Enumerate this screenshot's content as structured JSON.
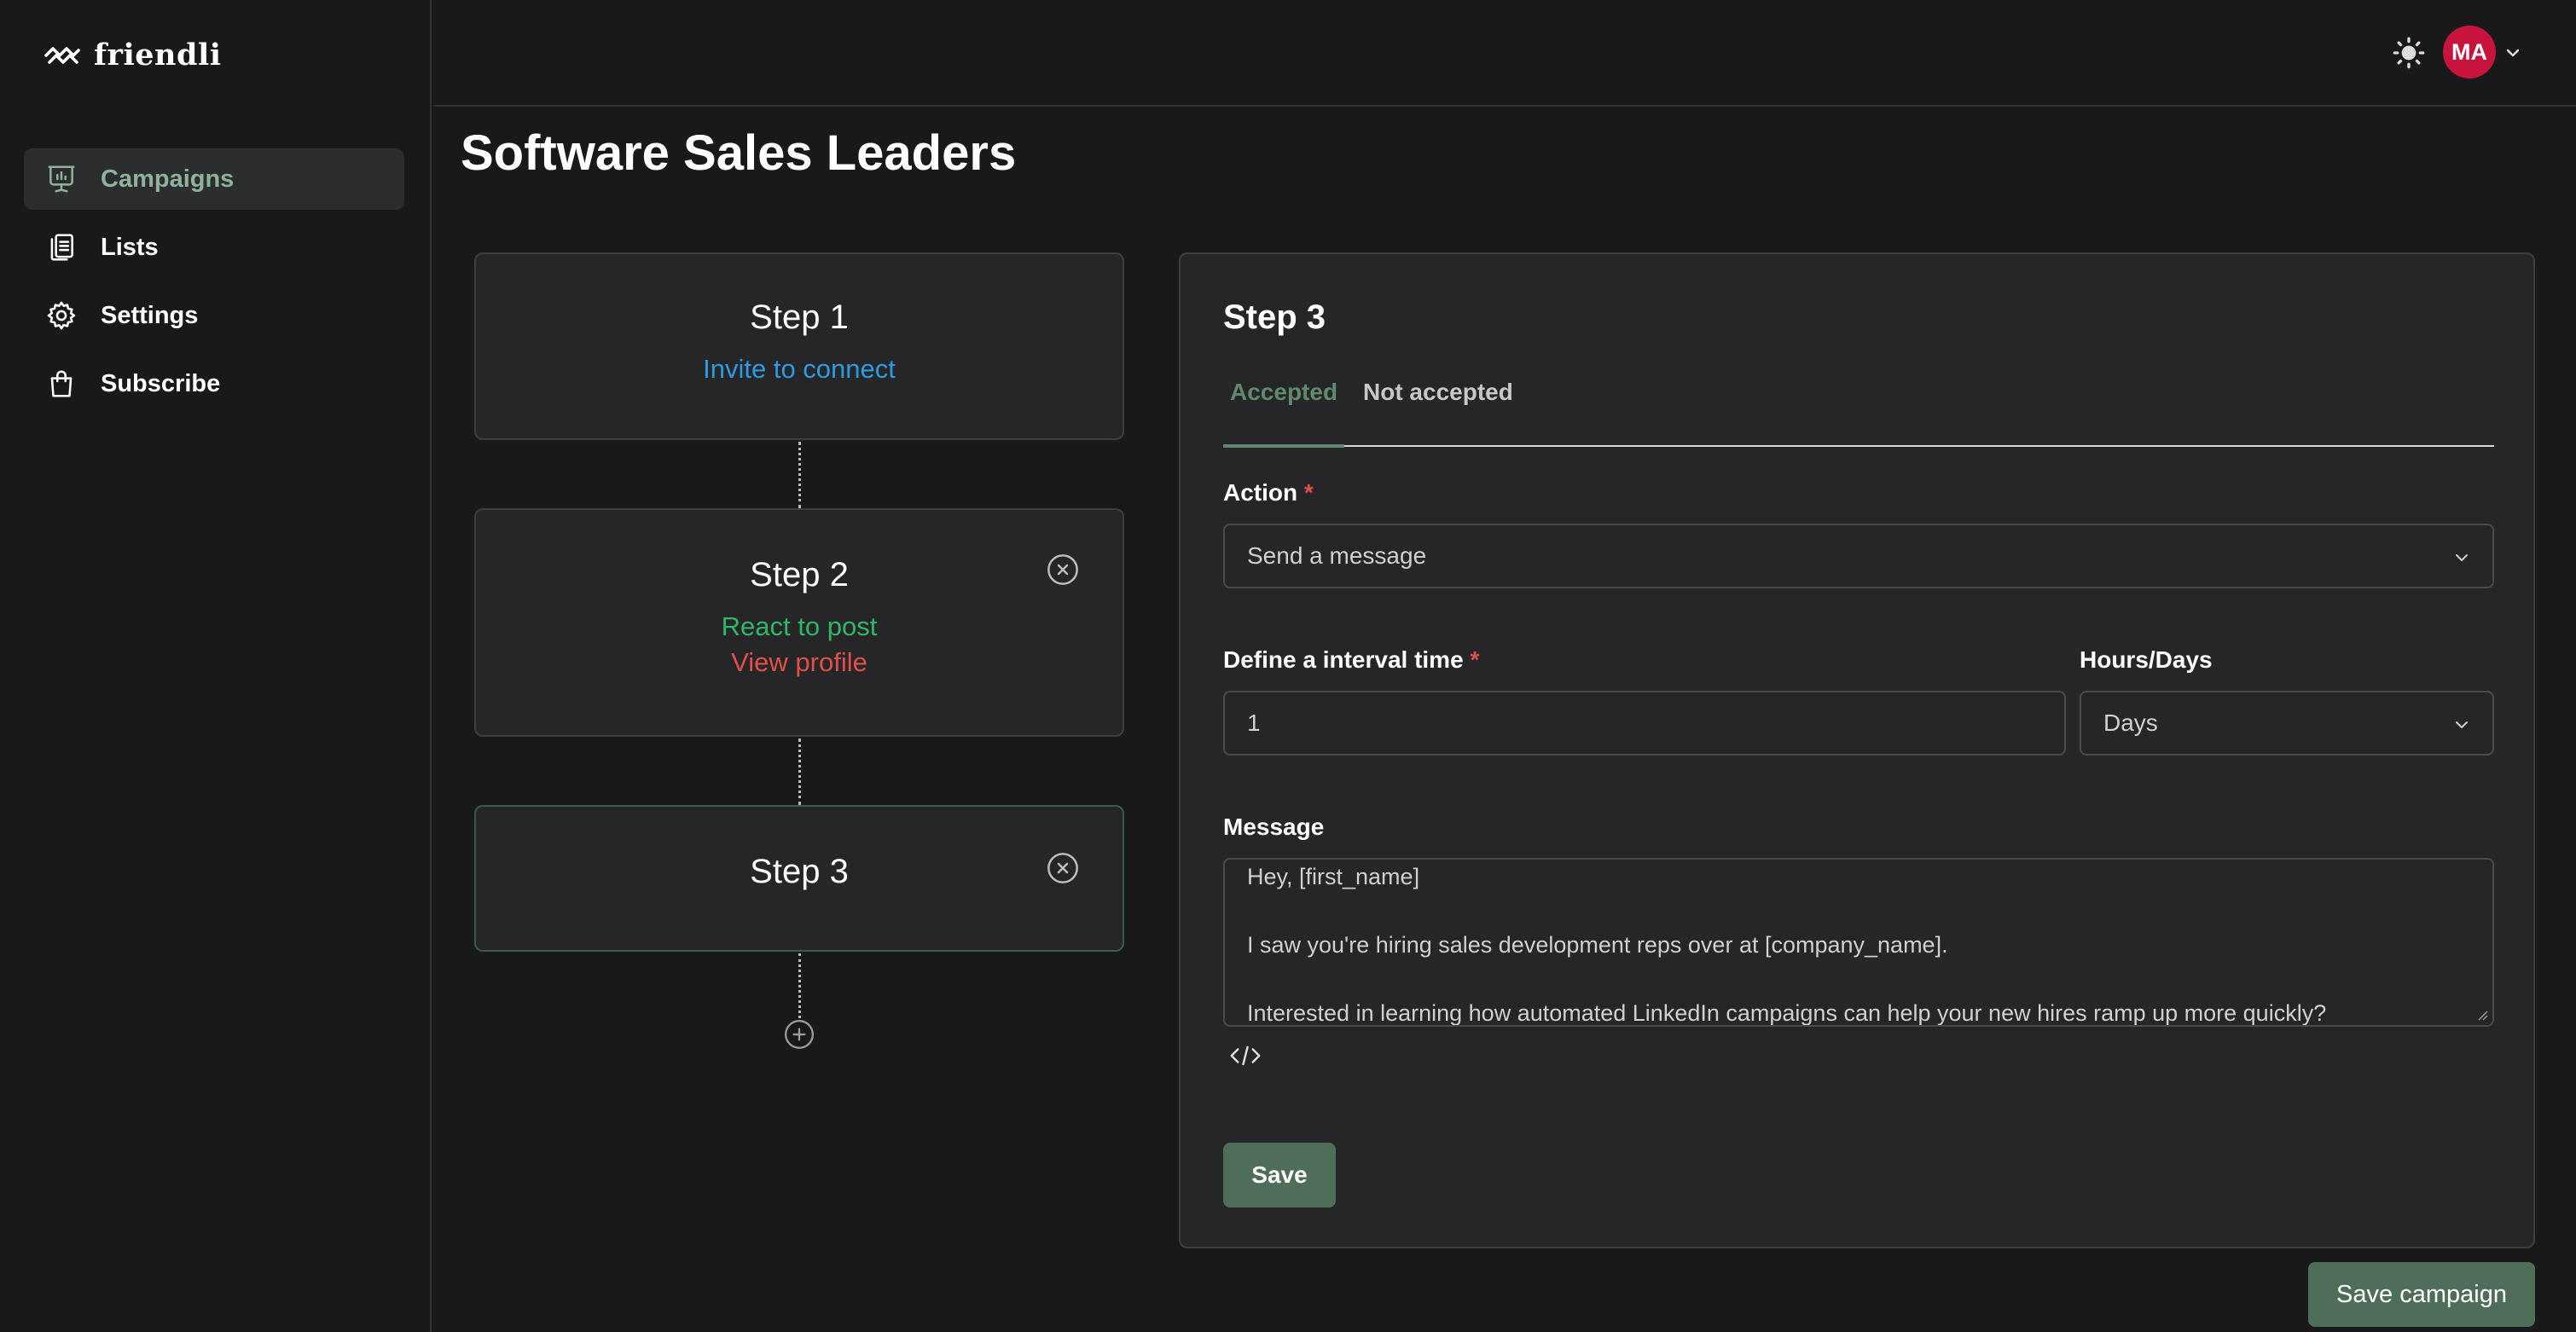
{
  "app": {
    "brand": "friendli"
  },
  "sidebar": {
    "items": [
      {
        "label": "Campaigns",
        "icon": "presentation-chart-icon",
        "active": true
      },
      {
        "label": "Lists",
        "icon": "document-list-icon",
        "active": false
      },
      {
        "label": "Settings",
        "icon": "gear-icon",
        "active": false
      },
      {
        "label": "Subscribe",
        "icon": "shopping-bag-icon",
        "active": false
      }
    ]
  },
  "header": {
    "theme_icon": "sun-icon",
    "avatar_initials": "MA",
    "avatar_color": "#c8143c"
  },
  "page": {
    "title": "Software Sales Leaders"
  },
  "steps": [
    {
      "title": "Step 1",
      "lines": [
        "Invite to connect"
      ]
    },
    {
      "title": "Step 2",
      "lines": [
        "React to post",
        "View profile"
      ]
    },
    {
      "title": "Step 3",
      "lines": []
    }
  ],
  "panel": {
    "title": "Step 3",
    "tabs": [
      {
        "label": "Accepted",
        "active": true
      },
      {
        "label": "Not accepted",
        "active": false
      }
    ],
    "action": {
      "label": "Action",
      "required_mark": "*",
      "value": "Send a message"
    },
    "interval": {
      "label": "Define a interval time",
      "required_mark": "*",
      "value": "1"
    },
    "unit": {
      "label": "Hours/Days",
      "value": "Days"
    },
    "message": {
      "label": "Message",
      "lines": [
        "Hey,  [first_name]",
        "",
        "I saw you're hiring sales development reps over at  [company_name].",
        "",
        "Interested in learning how automated LinkedIn campaigns can help your new hires ramp up more quickly?"
      ]
    },
    "save_label": "Save"
  },
  "footer": {
    "save_campaign_label": "Save campaign"
  },
  "colors": {
    "accent_green": "#4e6e5a",
    "active_tab": "#5f8a6e",
    "link_blue": "#2d9be0",
    "success_green": "#2eb865",
    "danger_red": "#e0504a"
  }
}
